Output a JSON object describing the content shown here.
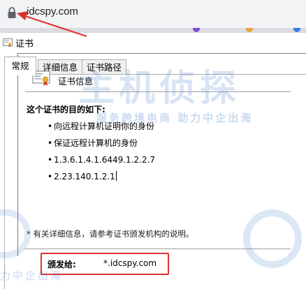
{
  "browser": {
    "url": "idcspy.com",
    "lock_icon": "lock-icon"
  },
  "dialog": {
    "title": "证书",
    "tabs": [
      {
        "label": "常规"
      },
      {
        "label": "详细信息"
      },
      {
        "label": "证书路径"
      }
    ],
    "cert_info": {
      "heading": "证书信息",
      "purpose_title": "这个证书的目的如下:",
      "purposes": [
        "向远程计算机证明你的身份",
        "保证远程计算机的身份",
        "1.3.6.1.4.1.6449.1.2.2.7",
        "2.23.140.1.2.1"
      ],
      "note": "* 有关详细信息，请参考证书颁发机构的说明。",
      "issued_to_label": "颁发给:",
      "issued_to_value": "*.idcspy.com"
    }
  },
  "watermark": {
    "main": "主机侦探",
    "slogan": "服务跨境电商 助力中企出海",
    "bottom": "力中企出海"
  },
  "colors": {
    "highlight": "#e03030",
    "watermark": "#4d85cc"
  }
}
